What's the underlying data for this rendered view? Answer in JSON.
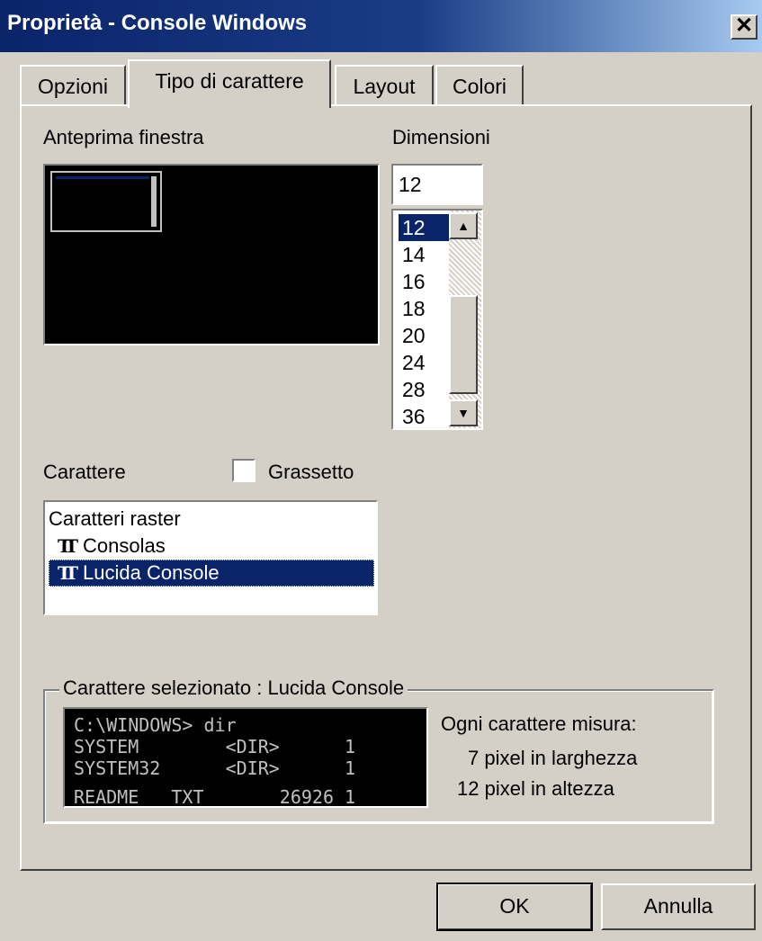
{
  "window": {
    "title": "Proprietà - Console Windows",
    "close_glyph": "✕"
  },
  "tabs": [
    {
      "label": "Opzioni"
    },
    {
      "label": "Tipo di carattere",
      "active": true
    },
    {
      "label": "Layout"
    },
    {
      "label": "Colori"
    }
  ],
  "preview": {
    "label": "Anteprima finestra"
  },
  "sizes": {
    "label": "Dimensioni",
    "value": "12",
    "items": [
      "12",
      "14",
      "16",
      "18",
      "20",
      "24",
      "28",
      "36"
    ],
    "selected": "12"
  },
  "font": {
    "label": "Carattere",
    "bold_label": "Grassetto",
    "bold_checked": false,
    "items": [
      "Caratteri raster",
      "Consolas",
      "Lucida Console"
    ],
    "selected": "Lucida Console",
    "truetype_icon": "truetype-font-icon"
  },
  "selected_font": {
    "legend": "Carattere selezionato : Lucida Console",
    "sample_lines": [
      "C:\\WINDOWS> dir",
      "SYSTEM        <DIR>      1",
      "SYSTEM32      <DIR>      1",
      "README   TXT       26926 1"
    ],
    "metrics_title": "Ogni carattere misura:",
    "width_text": "7 pixel in larghezza",
    "height_text": "12 pixel in altezza"
  },
  "buttons": {
    "ok": "OK",
    "cancel": "Annulla"
  },
  "colors": {
    "titlebar": "#0a246a",
    "face": "#d4d0c8",
    "selection": "#0a246a"
  }
}
